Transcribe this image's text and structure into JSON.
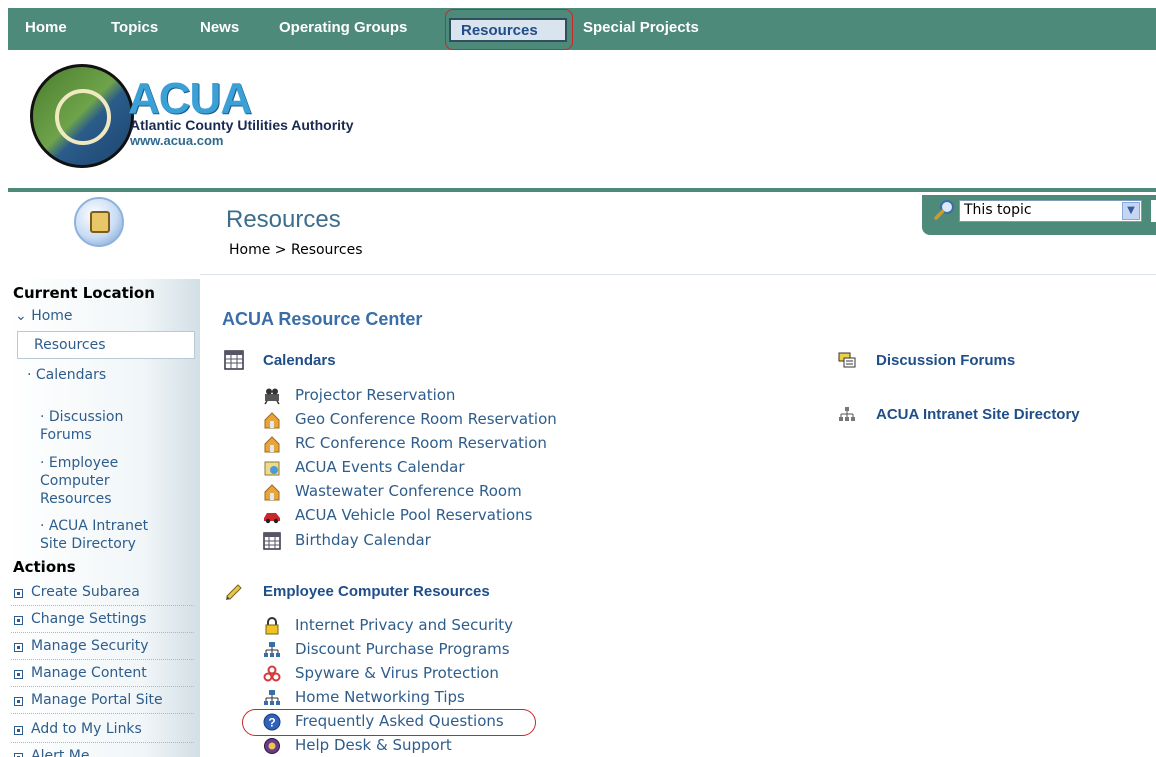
{
  "nav": {
    "items": [
      {
        "id": "home",
        "label": "Home"
      },
      {
        "id": "topics",
        "label": "Topics"
      },
      {
        "id": "news",
        "label": "News"
      },
      {
        "id": "operating-groups",
        "label": "Operating Groups"
      },
      {
        "id": "resources",
        "label": "Resources",
        "active": true
      },
      {
        "id": "special-projects",
        "label": "Special Projects"
      }
    ]
  },
  "logo": {
    "brand": "ACUA",
    "name": "Atlantic County Utilities Authority",
    "url": "www.acua.com"
  },
  "search": {
    "scope": "This topic"
  },
  "page": {
    "title": "Resources",
    "breadcrumb": {
      "home": "Home",
      "separator": ">",
      "current": "Resources"
    }
  },
  "sidebar": {
    "current_location": {
      "heading": "Current Location",
      "home": "Home",
      "selected": "Resources",
      "items": [
        "Calendars",
        "Discussion\nForums",
        "Employee\nComputer\nResources",
        "ACUA Intranet\nSite Directory"
      ]
    },
    "actions": {
      "heading": "Actions",
      "items": [
        "Create Subarea",
        "Change Settings",
        "Manage Security",
        "Manage Content",
        "Manage Portal Site",
        "Add to My Links",
        "Alert Me"
      ]
    }
  },
  "main": {
    "title": "ACUA Resource Center",
    "categories": {
      "calendars": {
        "label": "Calendars",
        "icon": "calendar-icon",
        "links": [
          {
            "label": "Projector Reservation",
            "icon": "projector-icon"
          },
          {
            "label": "Geo Conference Room Reservation",
            "icon": "room-icon"
          },
          {
            "label": "RC Conference Room Reservation",
            "icon": "room-icon"
          },
          {
            "label": "ACUA Events Calendar",
            "icon": "events-icon"
          },
          {
            "label": "Wastewater Conference Room",
            "icon": "room-icon"
          },
          {
            "label": "ACUA Vehicle Pool Reservations",
            "icon": "vehicle-icon"
          },
          {
            "label": "Birthday Calendar",
            "icon": "calendar-icon"
          }
        ]
      },
      "employee": {
        "label": "Employee Computer Resources",
        "icon": "pencil-icon",
        "links": [
          {
            "label": "Internet Privacy and Security",
            "icon": "lock-icon"
          },
          {
            "label": "Discount Purchase Programs",
            "icon": "network-icon"
          },
          {
            "label": "Spyware & Virus Protection",
            "icon": "biohazard-icon"
          },
          {
            "label": "Home Networking Tips",
            "icon": "network-icon"
          },
          {
            "label": "Frequently Asked Questions",
            "icon": "help-icon"
          },
          {
            "label": "Help Desk & Support",
            "icon": "support-icon"
          }
        ]
      },
      "forums": {
        "label": "Discussion Forums",
        "icon": "forum-icon"
      },
      "directory": {
        "label": "ACUA Intranet Site Directory",
        "icon": "sitemap-icon"
      }
    }
  },
  "colors": {
    "nav_green": "#4e8a7a",
    "link_blue": "#2e5d8c",
    "heading_blue": "#1f4e89",
    "annotation_red": "#c8282b"
  }
}
